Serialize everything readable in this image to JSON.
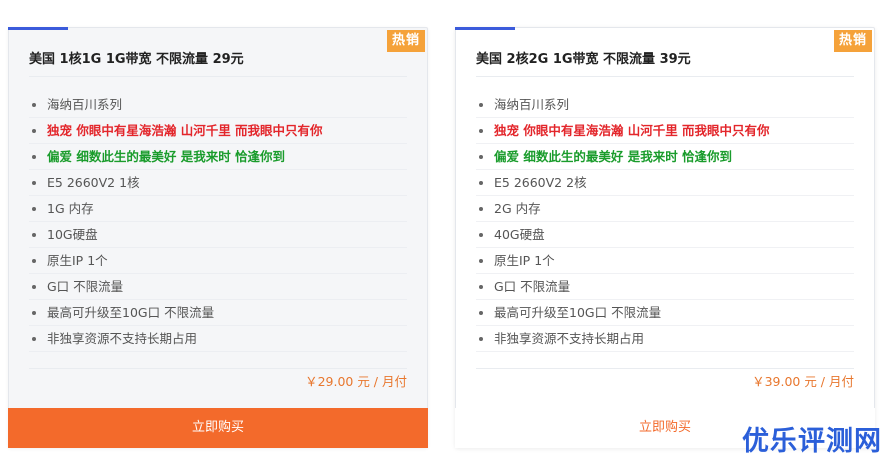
{
  "colors": {
    "accent_blue": "#3b5bdb",
    "badge_orange": "#f5a23a",
    "buy_orange": "#f36a2b",
    "price_orange": "#e8772e",
    "highlight_red": "#e3262b",
    "highlight_green": "#1a9c2c",
    "watermark_blue": "#2b5fd9"
  },
  "plans": [
    {
      "badge": "热销",
      "title": "美国 1核1G 1G带宽 不限流量 29元",
      "features": [
        "海纳百川系列",
        "独宠 你眼中有星海浩瀚 山河千里 而我眼中只有你",
        "偏爱 细数此生的最美好 是我来时 恰逢你到",
        "E5 2660V2 1核",
        "1G 内存",
        "10G硬盘",
        "原生IP 1个",
        "G口 不限流量",
        "最高可升级至10G口 不限流量",
        "非独享资源不支持长期占用"
      ],
      "price": "￥29.00 元 / 月付",
      "buy_label": "立即购买"
    },
    {
      "badge": "热销",
      "title": "美国 2核2G 1G带宽 不限流量 39元",
      "features": [
        "海纳百川系列",
        "独宠 你眼中有星海浩瀚 山河千里 而我眼中只有你",
        "偏爱 细数此生的最美好 是我来时 恰逢你到",
        "E5 2660V2 2核",
        "2G 内存",
        "40G硬盘",
        "原生IP 1个",
        "G口 不限流量",
        "最高可升级至10G口 不限流量",
        "非独享资源不支持长期占用"
      ],
      "price": "￥39.00 元 / 月付",
      "buy_label": "立即购买"
    }
  ],
  "watermark": "优乐评测网"
}
